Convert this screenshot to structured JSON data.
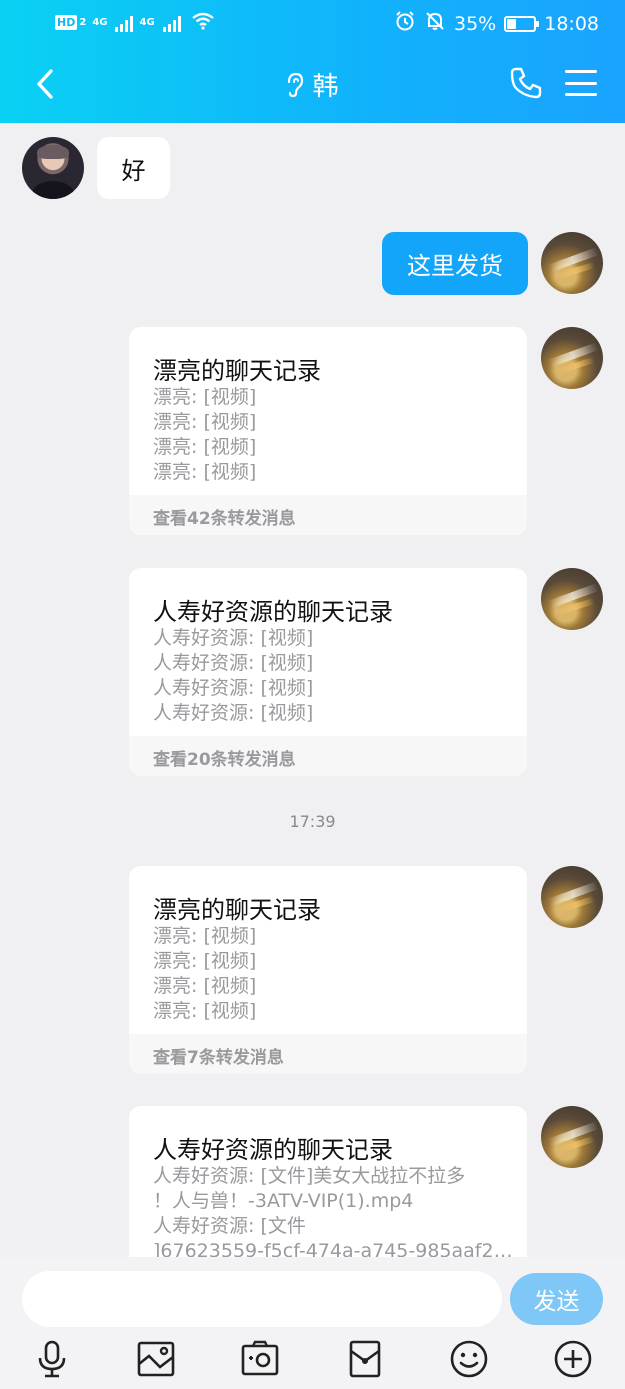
{
  "status_bar": {
    "hd_label": "HD",
    "hd_sub": "2",
    "net1": "4G",
    "net2": "4G",
    "battery_text": "35%",
    "battery_level": 0.35,
    "time": "18:08"
  },
  "header": {
    "title": "韩"
  },
  "messages": {
    "incoming_1": "好",
    "outgoing_1": "这里发货"
  },
  "cards": [
    {
      "title": "漂亮的聊天记录",
      "lines": [
        "漂亮: [视频]",
        "漂亮: [视频]",
        "漂亮: [视频]",
        "漂亮: [视频]"
      ],
      "footer": "查看42条转发消息"
    },
    {
      "title": "人寿好资源的聊天记录",
      "lines": [
        "人寿好资源: [视频]",
        "人寿好资源: [视频]",
        "人寿好资源: [视频]",
        "人寿好资源: [视频]"
      ],
      "footer": "查看20条转发消息"
    },
    {
      "title": "漂亮的聊天记录",
      "lines": [
        "漂亮: [视频]",
        "漂亮: [视频]",
        "漂亮: [视频]",
        "漂亮: [视频]"
      ],
      "footer": "查看7条转发消息"
    },
    {
      "title": "人寿好资源的聊天记录",
      "lines": [
        "人寿好资源: [文件]美女大战拉不拉多",
        "！人与兽！-3ATV-VIP(1).mp4",
        "人寿好资源: [文件",
        "]67623559-f5cf-474a-a745-985aaf20a..."
      ],
      "footer": ""
    }
  ],
  "timestamp": "17:39",
  "composer": {
    "input_value": "",
    "send_label": "发送"
  },
  "toolbar": {
    "icons": [
      "microphone-icon",
      "image-icon",
      "camera-icon",
      "red-packet-icon",
      "emoji-icon",
      "plus-icon"
    ]
  }
}
